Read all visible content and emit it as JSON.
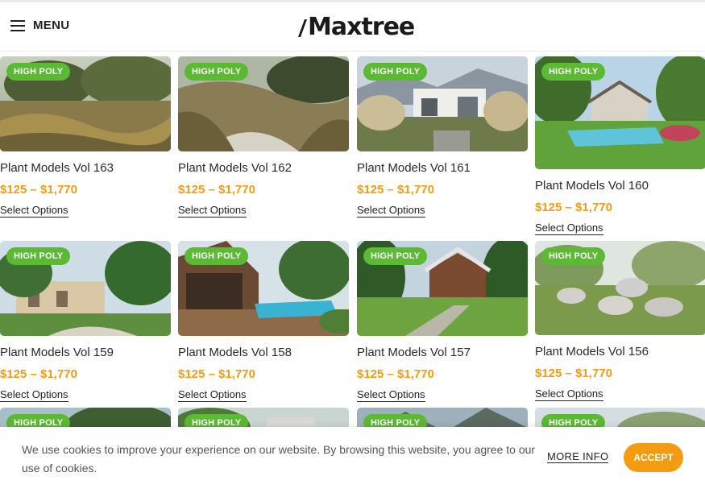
{
  "header": {
    "menu_label": "MENU",
    "logo_text": "Maxtree"
  },
  "products": [
    {
      "badge": "HIGH POLY",
      "title": "Plant Models Vol 163",
      "price": "$125 – $1,770",
      "action": "Select Options"
    },
    {
      "badge": "HIGH POLY",
      "title": "Plant Models Vol 162",
      "price": "$125 – $1,770",
      "action": "Select Options"
    },
    {
      "badge": "HIGH POLY",
      "title": "Plant Models Vol 161",
      "price": "$125 – $1,770",
      "action": "Select Options"
    },
    {
      "badge": "HIGH POLY",
      "title": "Plant Models Vol 160",
      "price": "$125 – $1,770",
      "action": "Select Options"
    },
    {
      "badge": "HIGH POLY",
      "title": "Plant Models Vol 159",
      "price": "$125 – $1,770",
      "action": "Select Options"
    },
    {
      "badge": "HIGH POLY",
      "title": "Plant Models Vol 158",
      "price": "$125 – $1,770",
      "action": "Select Options"
    },
    {
      "badge": "HIGH POLY",
      "title": "Plant Models Vol 157",
      "price": "$125 – $1,770",
      "action": "Select Options"
    },
    {
      "badge": "HIGH POLY",
      "title": "Plant Models Vol 156",
      "price": "$125 – $1,770",
      "action": "Select Options"
    },
    {
      "badge": "HIGH POLY"
    },
    {
      "badge": "HIGH POLY"
    },
    {
      "badge": "HIGH POLY"
    },
    {
      "badge": "HIGH POLY"
    }
  ],
  "cookie": {
    "text": "We use cookies to improve your experience on our website. By browsing this website, you agree to our use of cookies.",
    "more_info": "MORE INFO",
    "accept": "ACCEPT"
  },
  "colors": {
    "badge_green": "#5cb933",
    "price_orange": "#f39c12",
    "accept_orange": "#f39c12"
  }
}
